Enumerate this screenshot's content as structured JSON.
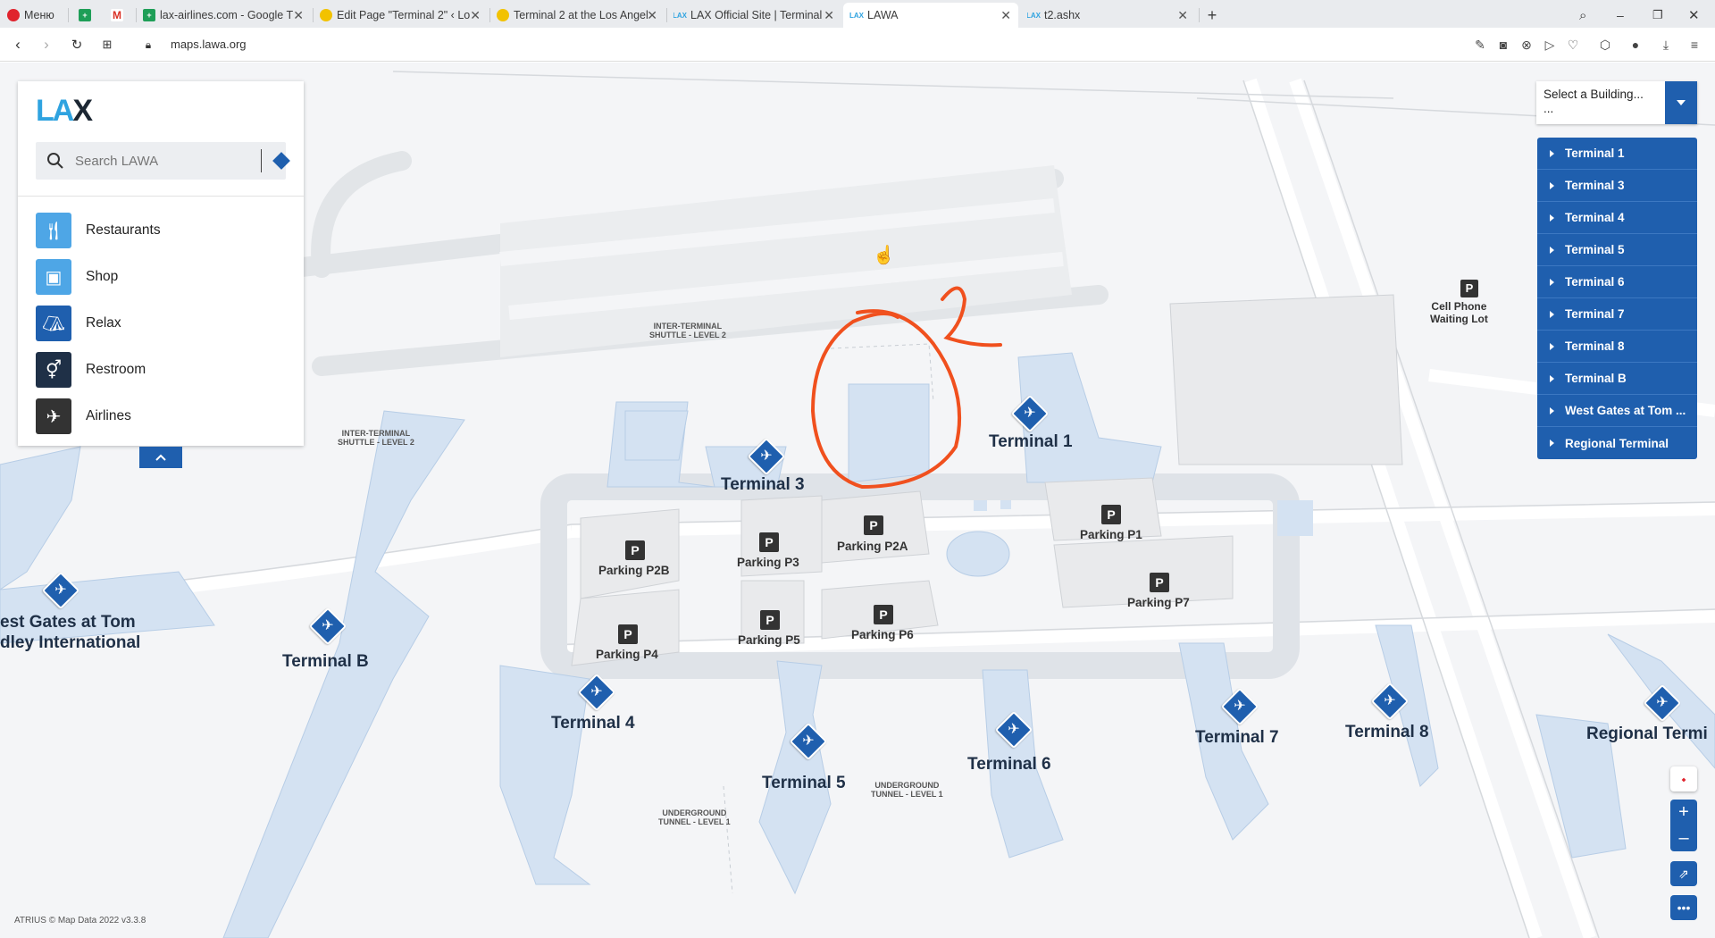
{
  "browser": {
    "tabs": [
      {
        "title": "Меню",
        "icon": "opera-icon"
      },
      {
        "title": "",
        "icon": "sheets-icon"
      },
      {
        "title": "",
        "icon": "gmail-icon"
      },
      {
        "title": "lax-airlines.com - Google T",
        "icon": "sheets-icon"
      },
      {
        "title": "Edit Page \"Terminal 2\" ‹ Lo",
        "icon": "wordpress-icon"
      },
      {
        "title": "Terminal 2 at the Los Angel",
        "icon": "wordpress-icon"
      },
      {
        "title": "LAX Official Site | Terminal",
        "icon": "lax-icon"
      },
      {
        "title": "LAWA",
        "icon": "lax-icon"
      },
      {
        "title": "t2.ashx",
        "icon": "lax-icon"
      }
    ],
    "url": "maps.lawa.org"
  },
  "panel": {
    "logo": "LAX",
    "search_placeholder": "Search LAWA",
    "categories": [
      {
        "label": "Restaurants",
        "icon": "fork-knife-icon",
        "color": "#4ea6e6"
      },
      {
        "label": "Shop",
        "icon": "shopping-bag-icon",
        "color": "#4ea6e6"
      },
      {
        "label": "Relax",
        "icon": "armchair-icon",
        "color": "#1f5fae"
      },
      {
        "label": "Restroom",
        "icon": "restroom-icon",
        "color": "#1f3047"
      },
      {
        "label": "Airlines",
        "icon": "airline-desk-icon",
        "color": "#333333"
      }
    ]
  },
  "building_selector": {
    "placeholder": "Select a Building...",
    "placeholder_suffix": "...",
    "items": [
      "Terminal 1",
      "Terminal 3",
      "Terminal 4",
      "Terminal 5",
      "Terminal 6",
      "Terminal 7",
      "Terminal 8",
      "Terminal B",
      "West Gates at Tom ...",
      "Regional Terminal"
    ]
  },
  "map": {
    "terminals": {
      "t1": "Terminal 1",
      "t3": "Terminal 3",
      "t4": "Terminal 4",
      "t5": "Terminal 5",
      "t6": "Terminal 6",
      "t7": "Terminal 7",
      "t8": "Terminal 8",
      "tb": "Terminal B",
      "reg": "Regional Termi",
      "west1": "est Gates at Tom",
      "west2": "dley International"
    },
    "parking": {
      "p2b": "Parking P2B",
      "p3": "Parking P3",
      "p2a": "Parking P2A",
      "p1": "Parking P1",
      "p7": "Parking P7",
      "p4": "Parking P4",
      "p5": "Parking P5",
      "p6": "Parking P6"
    },
    "parking_symbol": "P",
    "cell_lot": [
      "Cell Phone",
      "Waiting Lot"
    ],
    "shuttle1": [
      "INTER-TERMINAL",
      "SHUTTLE - LEVEL 2"
    ],
    "shuttle2": [
      "INTER-TERMINAL",
      "SHUTTLE - LEVEL 2"
    ],
    "tunnel1": [
      "UNDERGROUND",
      "TUNNEL - LEVEL 1"
    ],
    "tunnel2": [
      "UNDERGROUND",
      "TUNNEL - LEVEL 1"
    ],
    "annotation_text": "2",
    "annotation_color": "#f0501e"
  },
  "attribution": "ATRIUS  © Map Data 2022 v3.3.8",
  "colors": {
    "brand_blue": "#1f5fae",
    "lax_cyan": "#2fa3e0"
  }
}
